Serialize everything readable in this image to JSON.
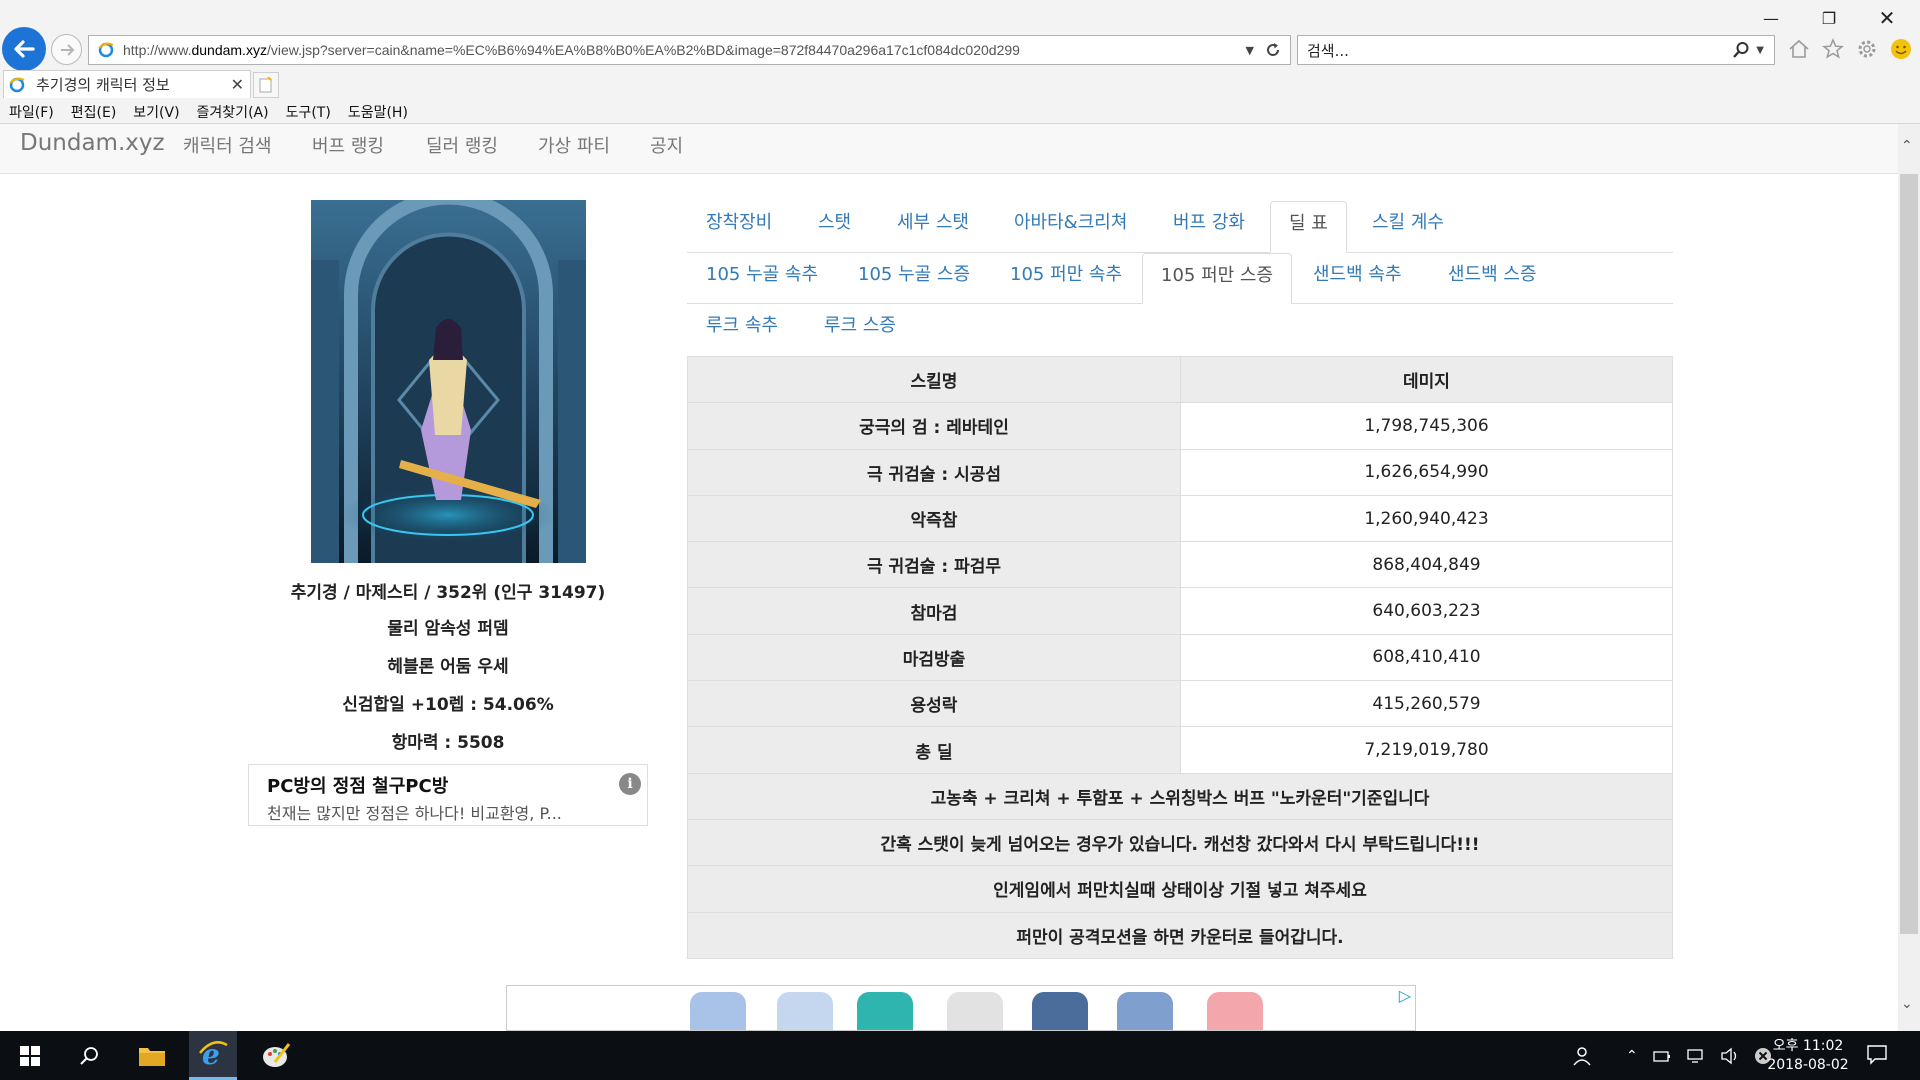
{
  "browser": {
    "url_prefix": "http://www.",
    "url_host": "dundam.xyz",
    "url_rest": "/view.jsp?server=cain&name=%EC%B6%94%EA%B8%B0%EA%B2%BD&image=872f84470a296a17c1cf084dc020d299",
    "search_placeholder": "검색...",
    "tab_title": "추기경의 캐릭터 정보",
    "menu": [
      "파일(F)",
      "편집(E)",
      "보기(V)",
      "즐겨찾기(A)",
      "도구(T)",
      "도움말(H)"
    ]
  },
  "site": {
    "brand": "Dundam.xyz",
    "nav": [
      "캐릭터 검색",
      "버프 랭킹",
      "딜러 랭킹",
      "가상 파티",
      "공지"
    ]
  },
  "character": {
    "line1": "추기경 / 마제스티 / 352위 (인구 31497)",
    "line2": "물리 암속성 퍼뎀",
    "line3": "헤블론 어둠 우세",
    "line4": "신검합일 +10렙 : 54.06%",
    "line5": "항마력 : 5508"
  },
  "ad": {
    "title": "PC방의 정점 철구PC방",
    "desc": "천재는 많지만 정점은 하나다! 비교환영, P...",
    "info": "i"
  },
  "tabs_main": [
    "장착장비",
    "스탯",
    "세부 스탯",
    "아바타&크리쳐",
    "버프 강화",
    "딜 표",
    "스킬 계수"
  ],
  "tabs_sub": [
    "105 누골 속추",
    "105 누골 스증",
    "105 퍼만 속추",
    "105 퍼만 스증",
    "샌드백 속추",
    "샌드백 스증",
    "루크 속추",
    "루크 스증"
  ],
  "table": {
    "header_skill": "스킬명",
    "header_damage": "데미지",
    "rows": [
      {
        "skill": "궁극의 검 : 레바테인",
        "damage": "1,798,745,306"
      },
      {
        "skill": "극 귀검술 : 시공섬",
        "damage": "1,626,654,990"
      },
      {
        "skill": "악즉참",
        "damage": "1,260,940,423"
      },
      {
        "skill": "극 귀검술 : 파검무",
        "damage": "868,404,849"
      },
      {
        "skill": "참마검",
        "damage": "640,603,223"
      },
      {
        "skill": "마검방출",
        "damage": "608,410,410"
      },
      {
        "skill": "용성락",
        "damage": "415,260,579"
      },
      {
        "skill": "총 딜",
        "damage": "7,219,019,780"
      }
    ],
    "notes": [
      "고농축 + 크리쳐 + 투함포 + 스위칭박스 버프 \"노카운터\"기준입니다",
      "간혹 스탯이 늦게 넘어오는 경우가 있습니다. 캐선창 갔다와서 다시 부탁드립니다!!!",
      "인게임에서 퍼만치실때 상태이상 기절 넣고 쳐주세요",
      "퍼만이 공격모션을 하면 카운터로 들어갑니다."
    ]
  },
  "taskbar": {
    "time": "오후 11:02",
    "date": "2018-08-02"
  },
  "colors": {
    "link": "#337ab7",
    "ie_blue": "#1e73d6",
    "taskbar": "#0b0f14"
  }
}
